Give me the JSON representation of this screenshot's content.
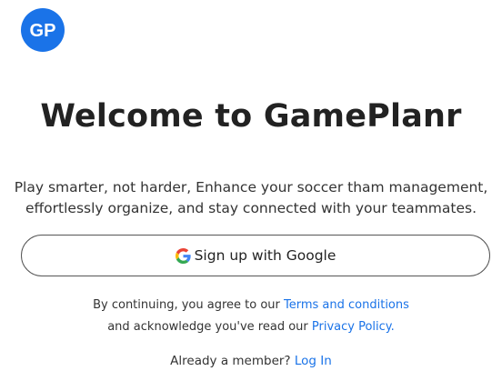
{
  "logo": {
    "text": "GP",
    "color": "#1a73e8",
    "icon": "gameplanr-logo"
  },
  "welcome": {
    "title": "Welcome to GamePlanr"
  },
  "intro": {
    "line1": "Play smarter, not harder, Enhance your soccer tham management,",
    "line2": "effortlessly organize, and stay connected with your teammates."
  },
  "google_signup": {
    "label": "Sign up with Google",
    "icon": "google-icon"
  },
  "legal": {
    "prefix1": "By continuing, you agree to our ",
    "terms_link": "Terms and conditions",
    "prefix2": "and acknowledge you've read our ",
    "privacy_link": "Privacy Policy."
  },
  "login": {
    "prompt": "Already a member? ",
    "link": "Log In"
  },
  "colors": {
    "accent": "#1a73e8",
    "text": "#222222"
  }
}
